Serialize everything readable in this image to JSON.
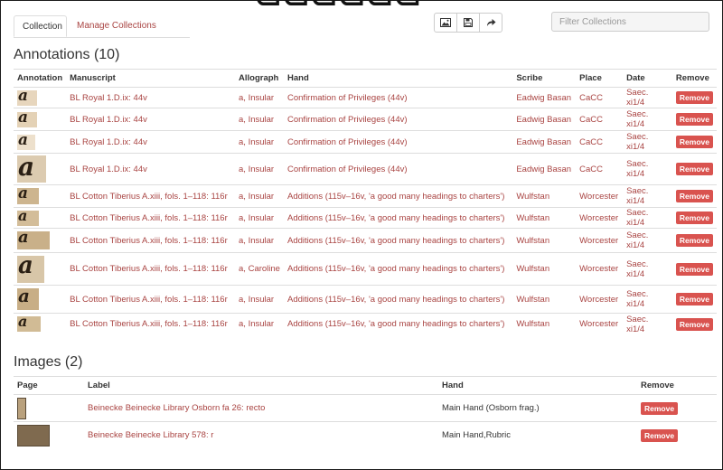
{
  "tabs": [
    {
      "label": "Collection"
    },
    {
      "label": "Manage Collections"
    }
  ],
  "toolbar": {
    "icons": [
      "image-icon",
      "save-icon",
      "share-icon"
    ]
  },
  "filter": {
    "placeholder": "Filter Collections",
    "value": ""
  },
  "annotations": {
    "title": "Annotations (10)",
    "columns": [
      "Annotation",
      "Manuscript",
      "Allograph",
      "Hand",
      "Scribe",
      "Place",
      "Date",
      "Remove"
    ],
    "remove_label": "Remove",
    "rows": [
      {
        "manuscript": "BL Royal 1.D.ix: 44v",
        "allograph": "a, Insular",
        "hand": "Confirmation of Privileges (44v)",
        "scribe": "Eadwig Basan",
        "place": "CaCC",
        "date": "Saec. xi1/4"
      },
      {
        "manuscript": "BL Royal 1.D.ix: 44v",
        "allograph": "a, Insular",
        "hand": "Confirmation of Privileges (44v)",
        "scribe": "Eadwig Basan",
        "place": "CaCC",
        "date": "Saec. xi1/4"
      },
      {
        "manuscript": "BL Royal 1.D.ix: 44v",
        "allograph": "a, Insular",
        "hand": "Confirmation of Privileges (44v)",
        "scribe": "Eadwig Basan",
        "place": "CaCC",
        "date": "Saec. xi1/4"
      },
      {
        "manuscript": "BL Royal 1.D.ix: 44v",
        "allograph": "a, Insular",
        "hand": "Confirmation of Privileges (44v)",
        "scribe": "Eadwig Basan",
        "place": "CaCC",
        "date": "Saec. xi1/4"
      },
      {
        "manuscript": "BL Cotton Tiberius A.xiii, fols. 1–118: 116r",
        "allograph": "a, Insular",
        "hand": "Additions (115v–16v, 'a good many headings to charters')",
        "scribe": "Wulfstan",
        "place": "Worcester",
        "date": "Saec. xi1/4"
      },
      {
        "manuscript": "BL Cotton Tiberius A.xiii, fols. 1–118: 116r",
        "allograph": "a, Insular",
        "hand": "Additions (115v–16v, 'a good many headings to charters')",
        "scribe": "Wulfstan",
        "place": "Worcester",
        "date": "Saec. xi1/4"
      },
      {
        "manuscript": "BL Cotton Tiberius A.xiii, fols. 1–118: 116r",
        "allograph": "a, Insular",
        "hand": "Additions (115v–16v, 'a good many headings to charters')",
        "scribe": "Wulfstan",
        "place": "Worcester",
        "date": "Saec. xi1/4"
      },
      {
        "manuscript": "BL Cotton Tiberius A.xiii, fols. 1–118: 116r",
        "allograph": "a, Caroline",
        "hand": "Additions (115v–16v, 'a good many headings to charters')",
        "scribe": "Wulfstan",
        "place": "Worcester",
        "date": "Saec. xi1/4"
      },
      {
        "manuscript": "BL Cotton Tiberius A.xiii, fols. 1–118: 116r",
        "allograph": "a, Insular",
        "hand": "Additions (115v–16v, 'a good many headings to charters')",
        "scribe": "Wulfstan",
        "place": "Worcester",
        "date": "Saec. xi1/4"
      },
      {
        "manuscript": "BL Cotton Tiberius A.xiii, fols. 1–118: 116r",
        "allograph": "a, Insular",
        "hand": "Additions (115v–16v, 'a good many headings to charters')",
        "scribe": "Wulfstan",
        "place": "Worcester",
        "date": "Saec. xi1/4"
      }
    ]
  },
  "images": {
    "title": "Images (2)",
    "columns": [
      "Page",
      "Label",
      "Hand",
      "Remove"
    ],
    "remove_label": "Remove",
    "rows": [
      {
        "label": "Beinecke Beinecke Library Osborn fa 26: recto",
        "hand": "Main Hand (Osborn frag.)"
      },
      {
        "label": "Beinecke Beinecke Library 578: r",
        "hand": "Main Hand,Rubric"
      }
    ]
  },
  "colors": {
    "link": "#a94442",
    "remove": "#d9534f"
  }
}
